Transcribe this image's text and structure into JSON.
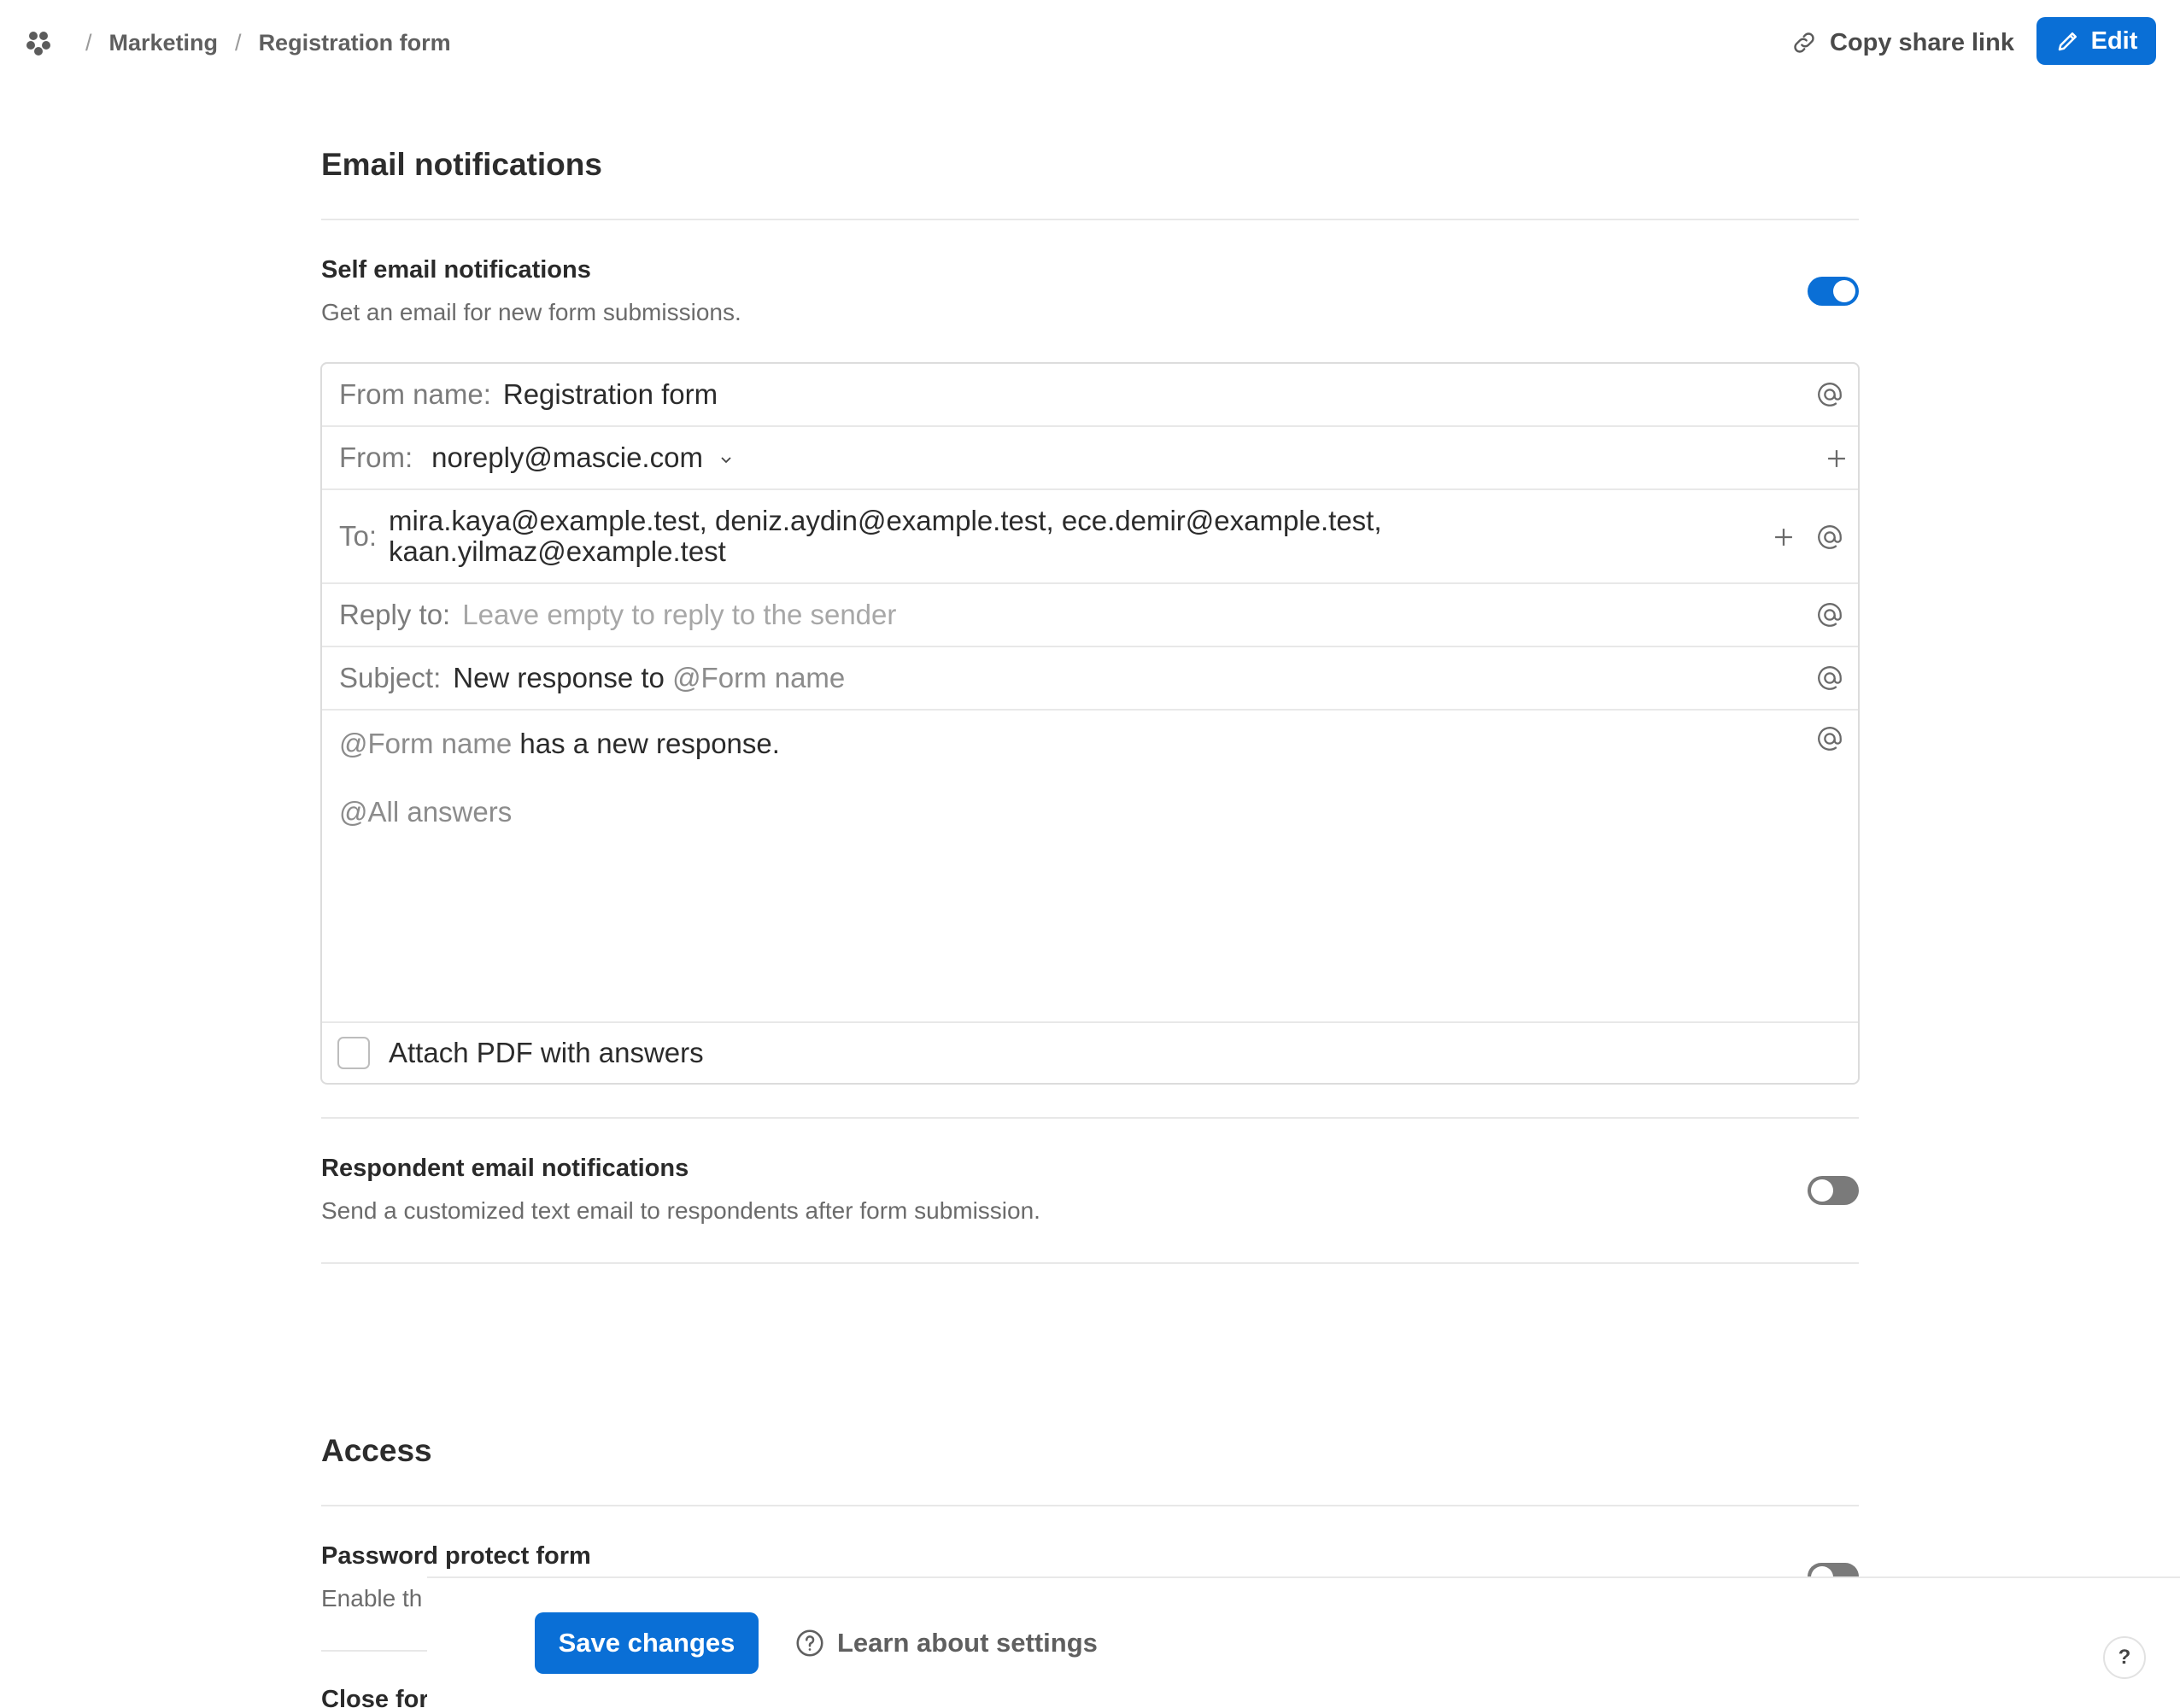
{
  "breadcrumb": {
    "items": [
      "Marketing",
      "Registration form"
    ],
    "separator": "/"
  },
  "header": {
    "copy_link_label": "Copy share link",
    "edit_label": "Edit"
  },
  "email_notifications": {
    "title": "Email notifications",
    "self": {
      "title": "Self email notifications",
      "description": "Get an email for new form submissions.",
      "enabled": true
    },
    "form": {
      "from_name_label": "From name:",
      "from_name_value": "Registration form",
      "from_label": "From:",
      "from_value": "noreply@mascie.com",
      "to_label": "To:",
      "to_line1": "mira.kaya@example.test, deniz.aydin@example.test, ece.demir@example.test,",
      "to_line2": "kaan.yilmaz@example.test",
      "reply_to_label": "Reply to:",
      "reply_to_placeholder": "Leave empty to reply to the sender",
      "subject_label": "Subject:",
      "subject_text": "New response to",
      "subject_mention": "@Form name",
      "body_mention": "@Form name",
      "body_text": "has a new response.",
      "body_answers_mention": "@All answers",
      "attach_label": "Attach PDF with answers",
      "attach_checked": false
    },
    "respondent": {
      "title": "Respondent email notifications",
      "description": "Send a customized text email to respondents after form submission.",
      "enabled": false
    }
  },
  "access": {
    "title": "Access",
    "password": {
      "title": "Password protect form",
      "description_partial": "Enable th",
      "enabled": false
    },
    "close_partial": "Close for"
  },
  "footer": {
    "save_label": "Save changes",
    "learn_label": "Learn about settings",
    "help_label": "?"
  },
  "colors": {
    "accent": "#0a6fd6",
    "toggle_off": "#7a7a7a",
    "divider": "#e8e8e8"
  },
  "icons": {
    "logo": "workspace-logo-icon",
    "link": "link-icon",
    "edit": "pencil-icon",
    "mention": "at-icon",
    "add": "plus-icon",
    "dropdown": "chevron-down-icon",
    "help": "question-circle-icon"
  }
}
